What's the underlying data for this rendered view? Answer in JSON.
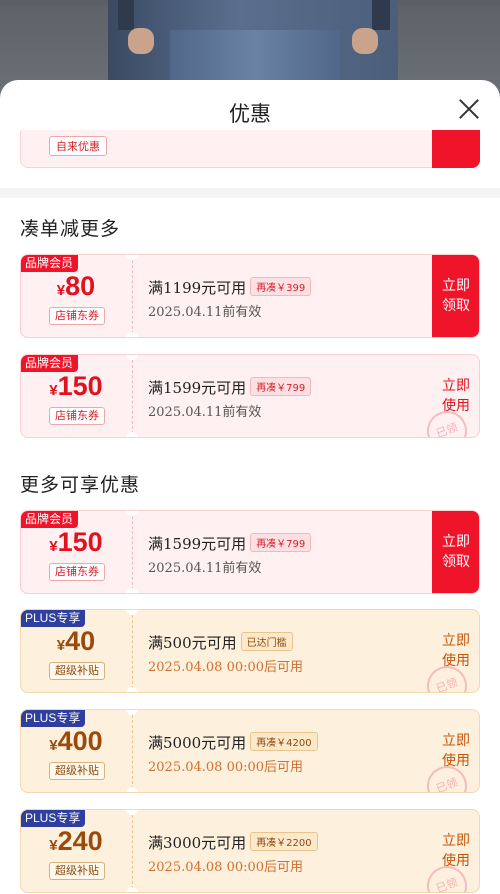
{
  "header": {
    "title": "优惠"
  },
  "partial": {
    "tag": "自来优惠"
  },
  "sections": [
    {
      "title": "凑单减更多"
    },
    {
      "title": "更多可享优惠"
    }
  ],
  "coupons": [
    {
      "badge": "品牌会员",
      "currency": "¥",
      "amount": "80",
      "kind": "店铺东券",
      "condition": "满1199元可用",
      "pill": "再凑￥399",
      "validity": "2025.04.11前有效",
      "action": "立即\n领取",
      "stamp": ""
    },
    {
      "badge": "品牌会员",
      "currency": "¥",
      "amount": "150",
      "kind": "店铺东券",
      "condition": "满1599元可用",
      "pill": "再凑￥799",
      "validity": "2025.04.11前有效",
      "action": "立即\n使用",
      "stamp": "已领"
    },
    {
      "badge": "品牌会员",
      "currency": "¥",
      "amount": "150",
      "kind": "店铺东券",
      "condition": "满1599元可用",
      "pill": "再凑￥799",
      "validity": "2025.04.11前有效",
      "action": "立即\n领取",
      "stamp": ""
    },
    {
      "badge": "PLUS专享",
      "currency": "¥",
      "amount": "40",
      "kind": "超级补贴",
      "condition": "满500元可用",
      "pill": "已达门槛",
      "validity": "2025.04.08 00:00后可用",
      "action": "立即\n使用",
      "stamp": "已领"
    },
    {
      "badge": "PLUS专享",
      "currency": "¥",
      "amount": "400",
      "kind": "超级补贴",
      "condition": "满5000元可用",
      "pill": "再凑￥4200",
      "validity": "2025.04.08 00:00后可用",
      "action": "立即\n使用",
      "stamp": "已领"
    },
    {
      "badge": "PLUS专享",
      "currency": "¥",
      "amount": "240",
      "kind": "超级补贴",
      "condition": "满3000元可用",
      "pill": "再凑￥2200",
      "validity": "2025.04.08 00:00后可用",
      "action": "立即\n使用",
      "stamp": "已领"
    }
  ]
}
